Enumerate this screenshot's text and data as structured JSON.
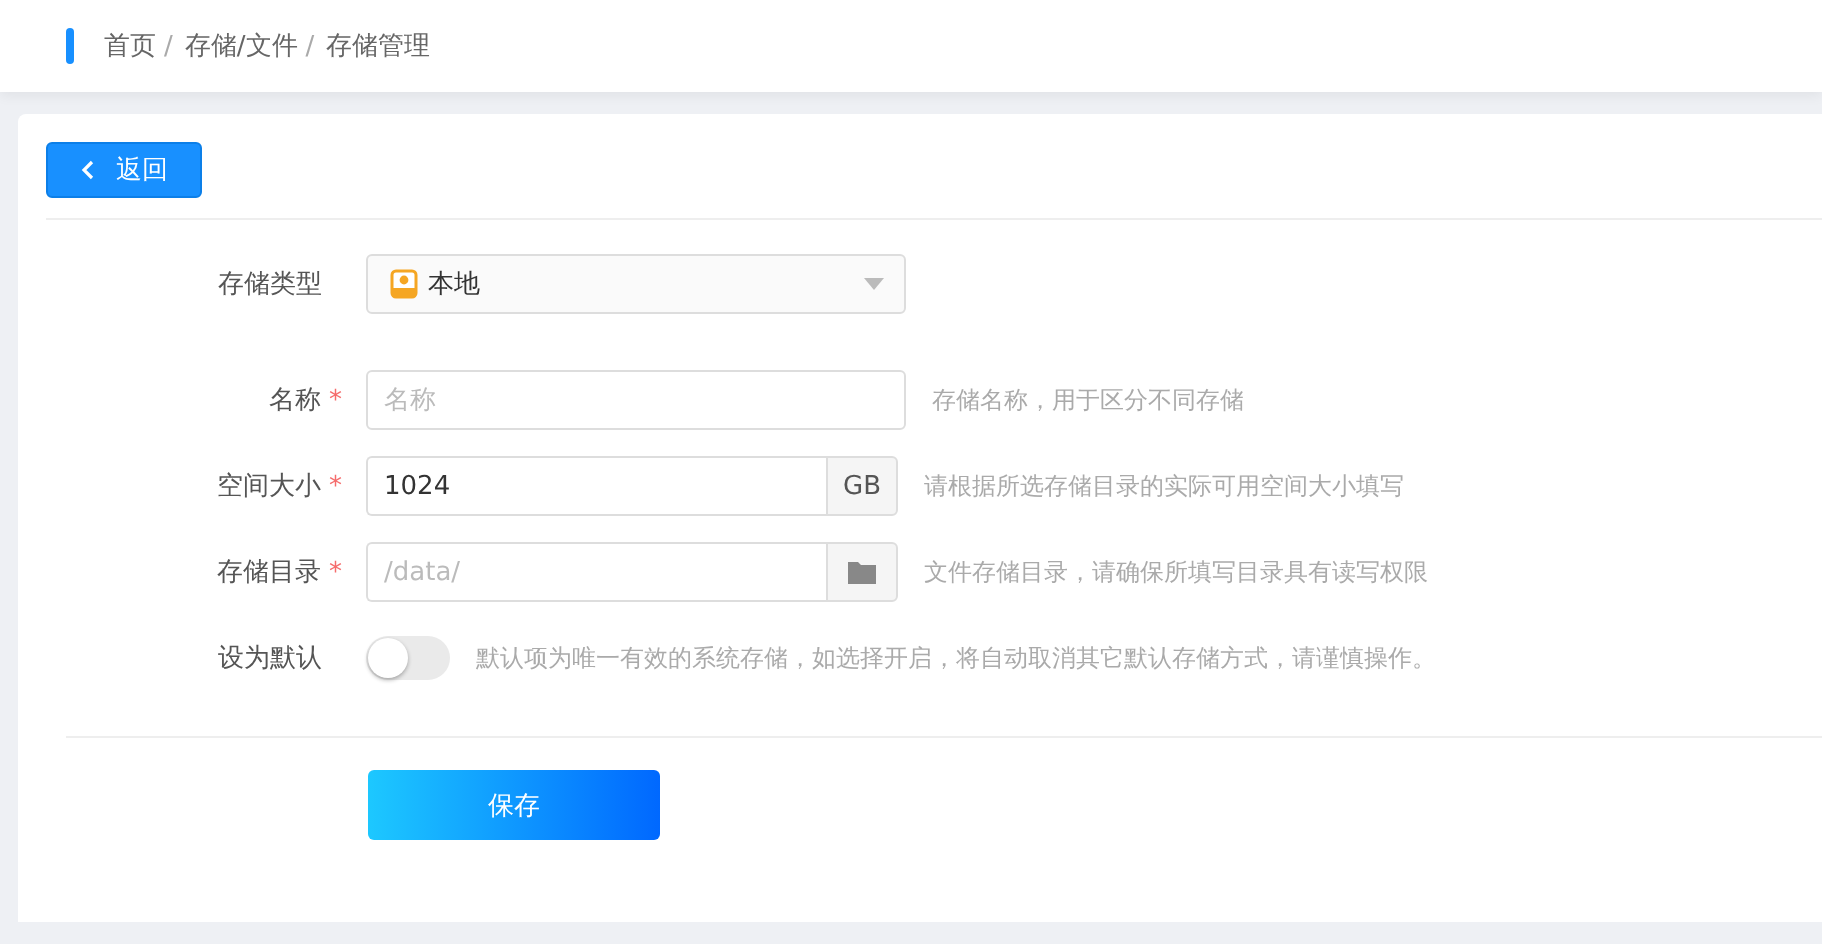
{
  "breadcrumb": [
    "首页",
    "存储/文件",
    "存储管理"
  ],
  "breadcrumb_separator": "/",
  "back_button": {
    "label": "返回"
  },
  "form": {
    "fields": [
      {
        "kind": "select",
        "label": "存储类型",
        "value": "本地"
      },
      {
        "kind": "text",
        "label": "名称",
        "required_mark": "*",
        "placeholder": "名称",
        "hint": "存储名称，用于区分不同存储"
      },
      {
        "kind": "suffix",
        "label": "空间大小",
        "required_mark": "*",
        "value": "1024",
        "suffix": "GB",
        "hint": "请根据所选存储目录的实际可用空间大小填写"
      },
      {
        "kind": "folder",
        "label": "存储目录",
        "required_mark": "*",
        "placeholder": "/data/",
        "hint": "文件存储目录，请确保所填写目录具有读写权限"
      },
      {
        "kind": "switch",
        "label": "设为默认",
        "on": false,
        "hint": "默认项为唯一有效的系统存储，如选择开启，将自动取消其它默认存储方式，请谨慎操作。"
      }
    ]
  },
  "save_button": {
    "label": "保存"
  }
}
